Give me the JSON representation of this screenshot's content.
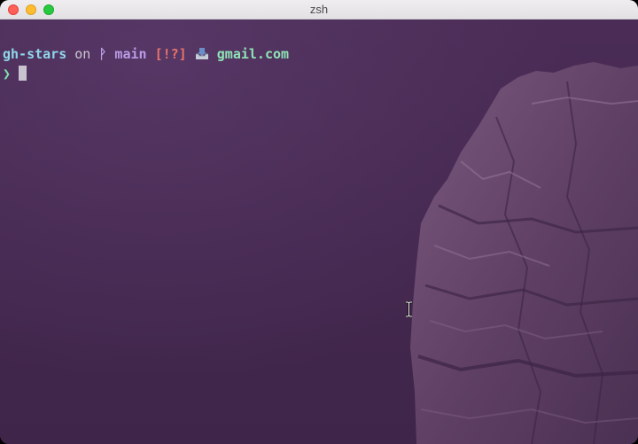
{
  "window": {
    "title": "zsh"
  },
  "terminal": {
    "repo": "gh-stars",
    "on_word": "on",
    "branch_icon": "git-branch-icon",
    "branch_symbol": "ᚹ",
    "branch": "main",
    "status": "[!?]",
    "mail_icon": "inbox-tray-icon",
    "email": "gmail.com",
    "prompt_symbol": "❯"
  },
  "colors": {
    "background": "#45294f",
    "repo": "#8fd6ea",
    "branch": "#b99ce6",
    "status": "#e8746c",
    "email": "#8ee3b5",
    "prompt": "#7fe0b0"
  }
}
